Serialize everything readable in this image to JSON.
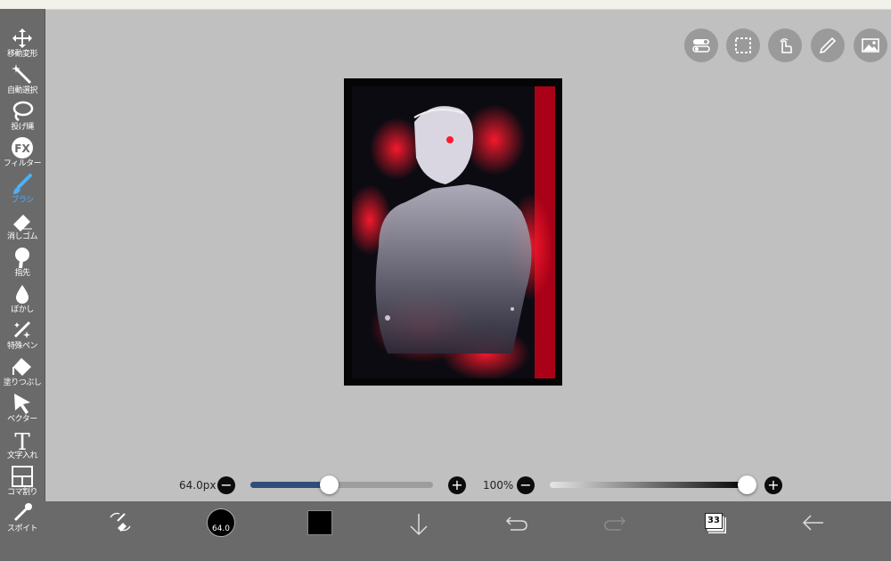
{
  "tools": [
    {
      "name": "move-transform",
      "label": "移動変形",
      "icon": "move-arrows-icon",
      "active": false
    },
    {
      "name": "magic-wand",
      "label": "自動選択",
      "icon": "magic-wand-icon",
      "active": false
    },
    {
      "name": "lasso",
      "label": "投げ縄",
      "icon": "lasso-icon",
      "active": false
    },
    {
      "name": "filter",
      "label": "フィルター",
      "icon": "fx-icon",
      "active": false
    },
    {
      "name": "brush",
      "label": "ブラシ",
      "icon": "brush-icon",
      "active": true
    },
    {
      "name": "eraser",
      "label": "消しゴム",
      "icon": "eraser-icon",
      "active": false
    },
    {
      "name": "finger",
      "label": "指先",
      "icon": "finger-icon",
      "active": false
    },
    {
      "name": "blur",
      "label": "ぼかし",
      "icon": "blur-drop-icon",
      "active": false
    },
    {
      "name": "special-pen",
      "label": "特殊ペン",
      "icon": "sparkle-pen-icon",
      "active": false
    },
    {
      "name": "fill",
      "label": "塗りつぶし",
      "icon": "bucket-icon",
      "active": false
    },
    {
      "name": "vector",
      "label": "ベクター",
      "icon": "cursor-arrow-icon",
      "active": false
    },
    {
      "name": "text",
      "label": "文字入れ",
      "icon": "text-t-icon",
      "active": false
    },
    {
      "name": "frame-divide",
      "label": "コマ割り",
      "icon": "panel-grid-icon",
      "active": false
    },
    {
      "name": "eyedropper",
      "label": "スポイト",
      "icon": "eyedropper-icon",
      "active": false
    }
  ],
  "quick_buttons": [
    "toggle-settings-icon",
    "selection-marquee-icon",
    "hand-touch-icon",
    "ruler-pen-icon",
    "image-icon"
  ],
  "brush_size": {
    "label": "64.0px",
    "value": 64.0,
    "min_label": "−",
    "max_label": "+",
    "fraction": 0.43
  },
  "opacity": {
    "label": "100%",
    "value": 100,
    "min_label": "−",
    "max_label": "+",
    "fraction": 1.0
  },
  "bottom_bar": {
    "brush_tool_icon": "brush-eraser-swap-icon",
    "brush_size_text": "64.0",
    "current_color": "#000000",
    "layers_count": "33",
    "icons": [
      "arrow-down-icon",
      "undo-icon",
      "redo-icon",
      "layers-icon",
      "back-arrow-icon"
    ]
  },
  "colors": {
    "accent": "#4ab0ff",
    "slider_fill": "#2f4f7a",
    "toolbar": "#6a6a6a",
    "workspace": "#c0c0c0",
    "art_red": "#e0001a"
  }
}
